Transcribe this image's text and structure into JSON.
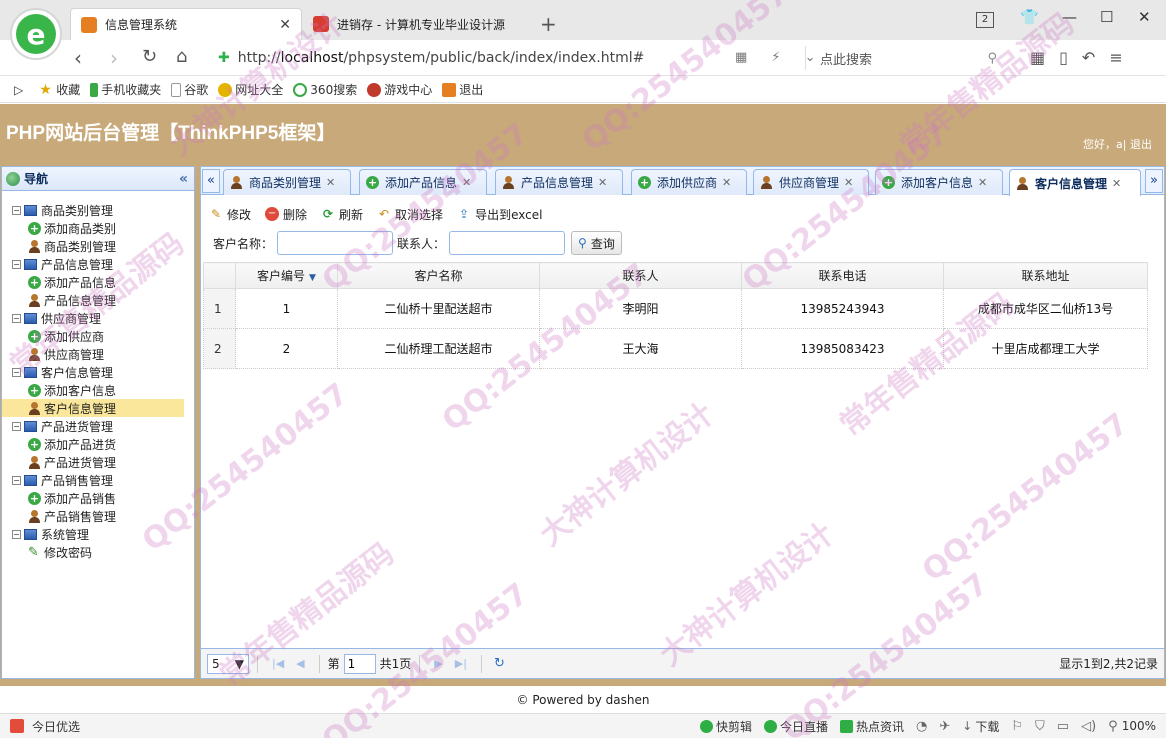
{
  "browser": {
    "tabs": [
      {
        "title": "信息管理系统",
        "active": true
      },
      {
        "title": "进销存 - 计算机专业毕业设计源",
        "active": false
      }
    ],
    "tab_count": "2",
    "url_prefix": "http://",
    "url_host": "localhost",
    "url_path": "/phpsystem/public/back/index/index.html#",
    "search_placeholder": "点此搜索",
    "bookmarks": [
      {
        "label": "收藏",
        "icon": "star-icon"
      },
      {
        "label": "手机收藏夹",
        "icon": "phone-icon"
      },
      {
        "label": "谷歌",
        "icon": "page-icon"
      },
      {
        "label": "网址大全",
        "icon": "globe-icon"
      },
      {
        "label": "360搜索",
        "icon": "search-icon"
      },
      {
        "label": "游戏中心",
        "icon": "game-icon"
      },
      {
        "label": "退出",
        "icon": "logout-icon"
      }
    ]
  },
  "app": {
    "title": "PHP网站后台管理【ThinkPHP5框架】",
    "greeting": "您好，a|",
    "logout": "退出",
    "brand_color": "#c8a97a"
  },
  "sidebar": {
    "title": "导航",
    "groups": [
      {
        "label": "商品类别管理",
        "children": [
          {
            "label": "添加商品类别",
            "icon": "add-icon"
          },
          {
            "label": "商品类别管理",
            "icon": "user-icon"
          }
        ]
      },
      {
        "label": "产品信息管理",
        "children": [
          {
            "label": "添加产品信息",
            "icon": "add-icon"
          },
          {
            "label": "产品信息管理",
            "icon": "user-icon"
          }
        ]
      },
      {
        "label": "供应商管理",
        "children": [
          {
            "label": "添加供应商",
            "icon": "add-icon"
          },
          {
            "label": "供应商管理",
            "icon": "user-icon"
          }
        ]
      },
      {
        "label": "客户信息管理",
        "children": [
          {
            "label": "添加客户信息",
            "icon": "add-icon"
          },
          {
            "label": "客户信息管理",
            "icon": "user-icon",
            "selected": true
          }
        ]
      },
      {
        "label": "产品进货管理",
        "children": [
          {
            "label": "添加产品进货",
            "icon": "add-icon"
          },
          {
            "label": "产品进货管理",
            "icon": "user-icon"
          }
        ]
      },
      {
        "label": "产品销售管理",
        "children": [
          {
            "label": "添加产品销售",
            "icon": "add-icon"
          },
          {
            "label": "产品销售管理",
            "icon": "user-icon"
          }
        ]
      },
      {
        "label": "系统管理",
        "children": [
          {
            "label": "修改密码",
            "icon": "pen-icon"
          }
        ]
      }
    ]
  },
  "tabs": [
    {
      "label": "商品类别管理",
      "icon": "user-icon"
    },
    {
      "label": "添加产品信息",
      "icon": "add-icon"
    },
    {
      "label": "产品信息管理",
      "icon": "user-icon"
    },
    {
      "label": "添加供应商",
      "icon": "add-icon"
    },
    {
      "label": "供应商管理",
      "icon": "user-icon"
    },
    {
      "label": "添加客户信息",
      "icon": "add-icon"
    },
    {
      "label": "客户信息管理",
      "icon": "user-icon",
      "active": true
    }
  ],
  "toolbar": {
    "edit": "修改",
    "delete": "删除",
    "refresh": "刷新",
    "cancel_select": "取消选择",
    "export": "导出到excel"
  },
  "search": {
    "customer_name_label": "客户名称：",
    "customer_name_value": "",
    "contact_label": "联系人：",
    "contact_value": "",
    "button": "查询"
  },
  "grid": {
    "columns": [
      "客户编号",
      "客户名称",
      "联系人",
      "联系电话",
      "联系地址"
    ],
    "rows": [
      {
        "rownum": "1",
        "cells": [
          "1",
          "二仙桥十里配送超市",
          "李明阳",
          "13985243943",
          "成都市成华区二仙桥13号"
        ]
      },
      {
        "rownum": "2",
        "cells": [
          "2",
          "二仙桥理工配送超市",
          "王大海",
          "13985083423",
          "十里店成都理工大学"
        ]
      }
    ]
  },
  "pager": {
    "page_size": "5",
    "page_prefix": "第",
    "page_value": "1",
    "page_total": "共1页",
    "info": "显示1到2,共2记录"
  },
  "footer": "© Powered by dashen",
  "statusbar": {
    "left": "今日优选",
    "items": [
      "快剪辑",
      "今日直播",
      "热点资讯",
      "下载"
    ],
    "zoom": "100%"
  },
  "watermark": [
    "QQ:254540457",
    "大神计算机设计",
    "常年售精品源码"
  ]
}
